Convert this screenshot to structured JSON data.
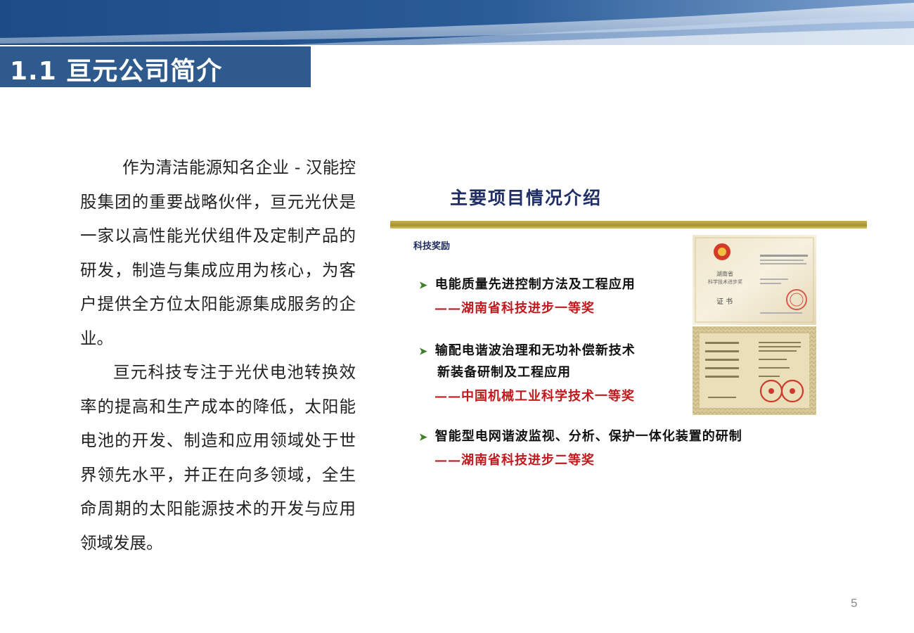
{
  "slide": {
    "title": "1.1  亘元公司简介",
    "page_number": "5"
  },
  "body": {
    "paragraph1": "作为清洁能源知名企业 - 汉能控股集团的重要战略伙伴，亘元光伏是一家以高性能光伏组件及定制产品的研发，制造与集成应用为核心，为客户提供全方位太阳能源集成服务的企业。",
    "paragraph2": "亘元科技专注于光伏电池转换效率的提高和生产成本的降低，太阳能电池的开发、制造和应用领域处于世界领先水平，并正在向多领域，全生命周期的太阳能源技术的开发与应用领域发展。"
  },
  "embedded_slide": {
    "heading": "主要项目情况介绍",
    "section_label": "科技奖励",
    "bullet_icon": "arrow-bullet-icon",
    "awards": [
      {
        "lines": [
          "电能质量先进控制方法及工程应用"
        ],
        "prize": "——湖南省科技进步一等奖"
      },
      {
        "lines": [
          "输配电谐波治理和无功补偿新技术",
          "新装备研制及工程应用"
        ],
        "prize": "——中国机械工业科学技术一等奖"
      },
      {
        "lines": [
          "智能型电网谐波监视、分析、保护一体化装置的研制"
        ],
        "prize": "——湖南省科技进步二等奖"
      }
    ],
    "certificate1": {
      "org": "湖南省",
      "subtitle": "科学技术进步奖",
      "word": "证 书"
    }
  },
  "colors": {
    "title_bg": "#2e5a8e",
    "prize_red": "#c0181c",
    "gold_bar": "#b89e36",
    "heading_navy": "#1f2f66"
  }
}
